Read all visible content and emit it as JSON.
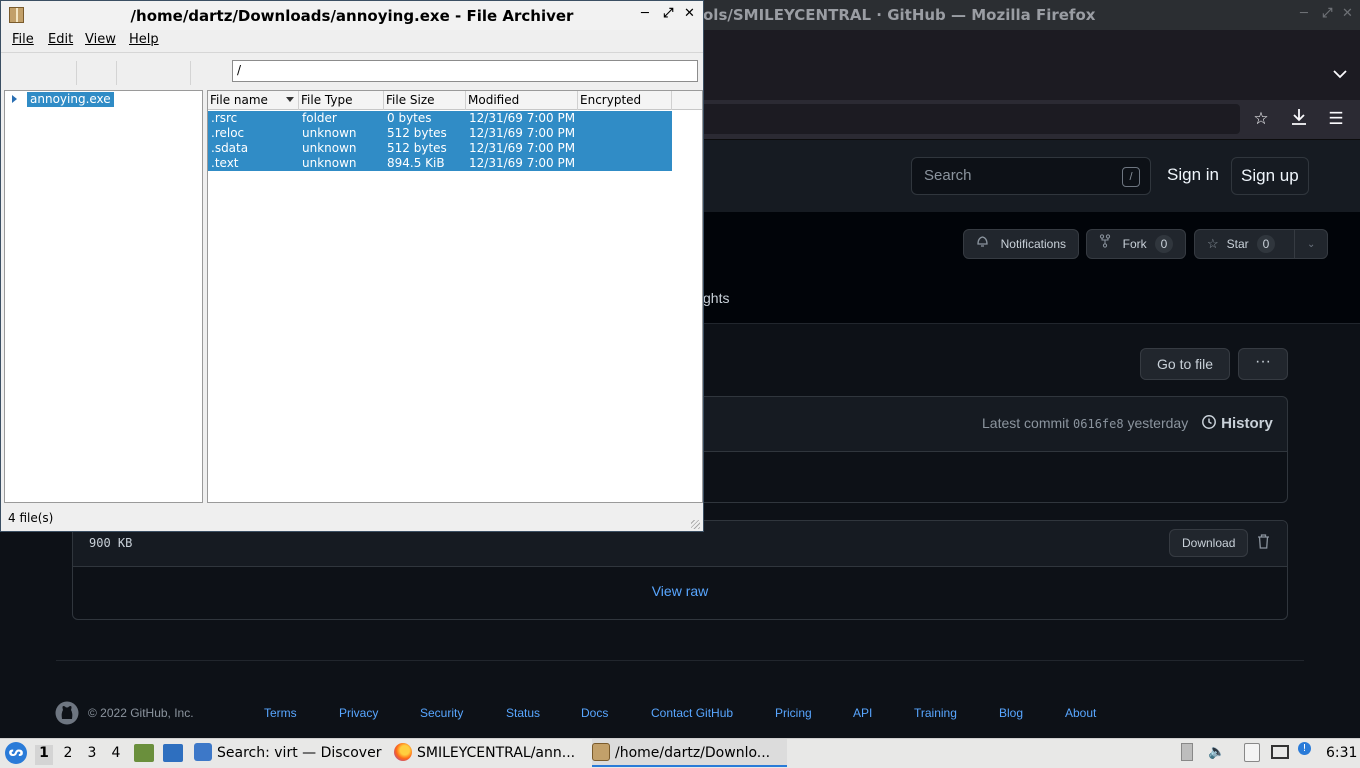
{
  "firefox": {
    "window_title": "ols/SMILEYCENTRAL · GitHub — Mozilla Firefox",
    "github": {
      "search_placeholder": "Search",
      "search_shortcut": "/",
      "sign_in": "Sign in",
      "sign_up": "Sign up",
      "notifications": "Notifications",
      "fork": "Fork",
      "fork_count": "0",
      "star": "Star",
      "star_count": "0",
      "tab_partial": "ghts",
      "go_to_file": "Go to file",
      "more": "···",
      "latest_commit_label": "Latest commit",
      "commit_sha": "0616fe8",
      "commit_time": "yesterday",
      "history": "History",
      "file_size": "900 KB",
      "download": "Download",
      "view_raw": "View raw",
      "footer": {
        "copyright": "© 2022 GitHub, Inc.",
        "links": [
          "Terms",
          "Privacy",
          "Security",
          "Status",
          "Docs",
          "Contact GitHub",
          "Pricing",
          "API",
          "Training",
          "Blog",
          "About"
        ]
      }
    }
  },
  "archiver": {
    "title": "/home/dartz/Downloads/annoying.exe - File Archiver",
    "menu": [
      "File",
      "Edit",
      "View",
      "Help"
    ],
    "path": "/",
    "tree": [
      "annoying.exe"
    ],
    "columns": [
      "File name",
      "File Type",
      "File Size",
      "Modified",
      "Encrypted"
    ],
    "rows": [
      {
        "name": ".rsrc",
        "type": "folder",
        "size": "0 bytes",
        "modified": "12/31/69 7:00 PM",
        "encrypted": ""
      },
      {
        "name": ".reloc",
        "type": "unknown",
        "size": "512 bytes",
        "modified": "12/31/69 7:00 PM",
        "encrypted": ""
      },
      {
        "name": ".sdata",
        "type": "unknown",
        "size": "512 bytes",
        "modified": "12/31/69 7:00 PM",
        "encrypted": ""
      },
      {
        "name": ".text",
        "type": "unknown",
        "size": "894.5 KiB",
        "modified": "12/31/69 7:00 PM",
        "encrypted": ""
      }
    ],
    "status": "4 file(s)"
  },
  "taskbar": {
    "workspaces": [
      "1",
      "2",
      "3",
      "4"
    ],
    "tasks": [
      "Search: virt — Discover",
      "SMILEYCENTRAL/ann...",
      "/home/dartz/Downlo..."
    ],
    "clock": "6:31"
  }
}
